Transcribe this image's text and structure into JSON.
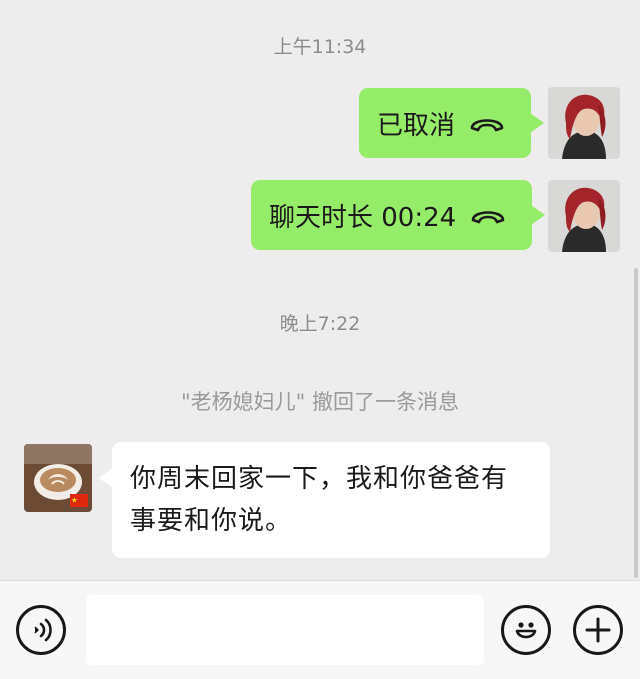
{
  "chat": {
    "timestamp_1": "上午11:34",
    "message_1": {
      "text": "已取消",
      "icon": "phone-hangup-icon"
    },
    "message_2": {
      "text": "聊天时长 00:24",
      "icon": "phone-hangup-icon"
    },
    "timestamp_2": "晚上7:22",
    "system_notice": "\"老杨媳妇儿\" 撤回了一条消息",
    "message_3": {
      "text": "你周末回家一下，我和你爸爸有事要和你说。"
    }
  },
  "input_bar": {
    "voice_icon": "voice-icon",
    "emoji_icon": "emoji-icon",
    "plus_icon": "plus-icon",
    "input_value": ""
  },
  "colors": {
    "background": "#ededed",
    "outgoing_bubble": "#95ec69",
    "incoming_bubble": "#ffffff",
    "system_text": "#9a9a9a"
  }
}
